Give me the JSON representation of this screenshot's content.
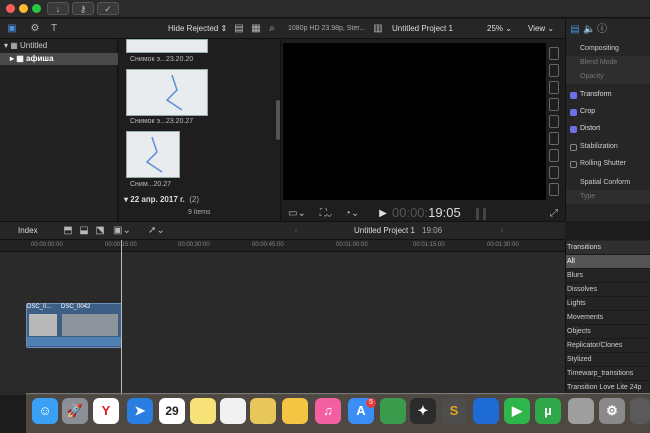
{
  "toolbar": {
    "filter_label": "Hide Rejected",
    "format_label": "1080p HD 23.98p, Ster...",
    "project_title": "Untitled Project 1",
    "zoom": "25%",
    "view_label": "View"
  },
  "libraries": {
    "items": [
      {
        "label": "Untitled"
      },
      {
        "label": "афиша"
      }
    ]
  },
  "browser": {
    "clips": [
      {
        "caption": "Снимок э...23.20.20"
      },
      {
        "caption": "Снимок э...23.20.27"
      },
      {
        "caption": "Сним...20.27"
      }
    ],
    "date_group": "22 апр. 2017 г.",
    "date_count": "(2)",
    "item_count": "9 items"
  },
  "viewer": {
    "timecode_prefix": "00:00:",
    "timecode": "19:05"
  },
  "inspector": {
    "items": [
      {
        "label": "Compositing",
        "checkbox": false,
        "checked": false
      },
      {
        "label": "Blend Mode",
        "checkbox": false,
        "checked": false
      },
      {
        "label": "Opacity",
        "checkbox": false,
        "checked": false
      },
      {
        "label": "Transform",
        "checkbox": true,
        "checked": true
      },
      {
        "label": "Crop",
        "checkbox": true,
        "checked": true
      },
      {
        "label": "Distort",
        "checkbox": true,
        "checked": true
      },
      {
        "label": "Stabilization",
        "checkbox": true,
        "checked": false
      },
      {
        "label": "Rolling Shutter",
        "checkbox": true,
        "checked": false
      },
      {
        "label": "Spatial Conform",
        "checkbox": false,
        "checked": false
      },
      {
        "label": "Type",
        "checkbox": false,
        "checked": false
      }
    ]
  },
  "timeline": {
    "index_label": "Index",
    "project_title": "Untitled Project 1",
    "duration": "19:06",
    "ticks": [
      "00:00:00:00",
      "00:00:15:00",
      "00:00:30:00",
      "00:00:45:00",
      "00:01:00:00",
      "00:01:15:00",
      "00:01:30:00"
    ],
    "clips": [
      {
        "label": "DSC_0..."
      },
      {
        "label": "DSC_0042"
      }
    ]
  },
  "transitions": {
    "header": "Transitions",
    "items": [
      "All",
      "Blurs",
      "Dissolves",
      "Lights",
      "Movements",
      "Objects",
      "Replicator/Clones",
      "Stylized",
      "Timewarp_transitions",
      "Transition Love Lite 24p"
    ]
  },
  "dock": {
    "calendar_day": "29",
    "badge": "5"
  }
}
